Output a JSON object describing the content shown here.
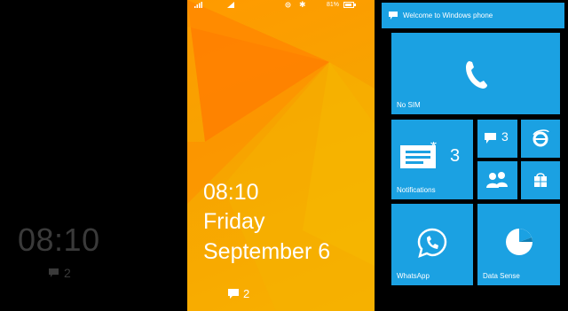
{
  "glance": {
    "time": "08:10",
    "message_count": "2"
  },
  "lock": {
    "status": {
      "battery": "81%"
    },
    "time": "08:10",
    "day": "Friday",
    "date": "September 6",
    "message_count": "2"
  },
  "start": {
    "header": "Welcome to Windows  phone",
    "tiles": {
      "phone": {
        "label": "No SIM",
        "icon": "phone-icon"
      },
      "notifications": {
        "label": "Notifications",
        "count": "3",
        "icon": "message-icon"
      },
      "messaging": {
        "count": "3",
        "icon": "messaging-icon"
      },
      "ie": {
        "icon": "internet-explorer-icon"
      },
      "people": {
        "icon": "people-icon"
      },
      "store": {
        "icon": "store-icon"
      },
      "whatsapp": {
        "label": "WhatsApp",
        "icon": "whatsapp-icon"
      },
      "datasense": {
        "label": "Data Sense",
        "icon": "data-sense-icon"
      }
    }
  },
  "colors": {
    "tile": "#1ba1e2",
    "lock_bg": "#f7a300",
    "glance_text": "#3a3a3a"
  }
}
